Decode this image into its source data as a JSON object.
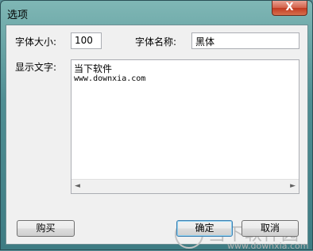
{
  "window": {
    "title": "选项",
    "close_glyph": "X"
  },
  "form": {
    "font_size_label": "字体大小:",
    "font_size_value": "100",
    "font_name_label": "字体名称:",
    "font_name_value": "黑体",
    "display_text_label": "显示文字:",
    "display_text_lines": [
      "当下软件",
      "www.downxia.com"
    ]
  },
  "buttons": {
    "buy": "购买",
    "ok": "确定",
    "cancel": "取消"
  },
  "scrollbar": {
    "left_arrow": "◄",
    "right_arrow": "►"
  },
  "watermark": {
    "name": "当下软件园",
    "url": "www.downxia.com",
    "logo": "watermark-logo-icon"
  }
}
